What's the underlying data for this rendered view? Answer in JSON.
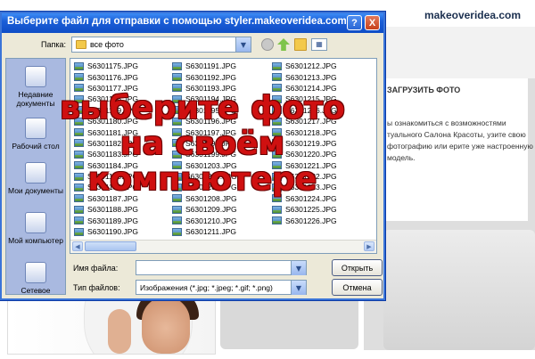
{
  "site": {
    "logo": "makeoveridea.com",
    "panel_title": "ЗАГРУЗИТЬ ФОТО",
    "panel_text": "ы ознакомиться с возможностями туального Салона Красоты, узите свою фотографию или ерите уже настроенную модель."
  },
  "dialog": {
    "title": "Выберите файл для отправки с помощью styler.makeoveridea.com",
    "help_label": "?",
    "close_label": "X",
    "folder_label": "Папка:",
    "folder_value": "все фото",
    "views_icon": "views-menu-icon",
    "places": [
      {
        "label": "Недавние документы",
        "icon": "recent-documents-icon"
      },
      {
        "label": "Рабочий стол",
        "icon": "desktop-icon"
      },
      {
        "label": "Мои документы",
        "icon": "my-documents-icon"
      },
      {
        "label": "Мой компьютер",
        "icon": "my-computer-icon"
      },
      {
        "label": "Сетевое",
        "icon": "network-icon"
      }
    ],
    "files": {
      "col1": [
        "S6301175.JPG",
        "S6301176.JPG",
        "S6301177.JPG",
        "S6301178.JPG",
        "S6301179.JPG",
        "S6301180.JPG",
        "S6301181.JPG",
        "S6301182.JPG",
        "S6301183.JPG",
        "S6301184.JPG",
        "S6301185.JPG",
        "S6301186.JPG",
        "S6301187.JPG",
        "S6301188.JPG",
        "S6301189.JPG",
        "S6301190.JPG"
      ],
      "col2": [
        "S6301191.JPG",
        "S6301192.JPG",
        "S6301193.JPG",
        "S6301194.JPG",
        "S6301195.JPG",
        "S6301196.JPG",
        "S6301197.JPG",
        "S6301198.JPG",
        "S6301199.JPG",
        "S6301203.JPG",
        "S6301206.JPG",
        "S6301207.JPG",
        "S6301208.JPG",
        "S6301209.JPG",
        "S6301210.JPG",
        "S6301211.JPG"
      ],
      "col3": [
        "S6301212.JPG",
        "S6301213.JPG",
        "S6301214.JPG",
        "S6301215.JPG",
        "S6301216.JPG",
        "S6301217.JPG",
        "S6301218.JPG",
        "S6301219.JPG",
        "S6301220.JPG",
        "S6301221.JPG",
        "S6301222.JPG",
        "S6301223.JPG",
        "S6301224.JPG",
        "S6301225.JPG",
        "S6301226.JPG"
      ]
    },
    "filename_label": "Имя файла:",
    "filename_value": "",
    "filetype_label": "Тип файлов:",
    "filetype_value": "Изображения (*.jpg; *.jpeg; *.gif; *.png)",
    "open_button": "Открыть",
    "cancel_button": "Отмена"
  },
  "overlay": {
    "line1": "выберите фото",
    "line2": "на своём",
    "line3": "компьютере",
    "color": "#cf1010"
  }
}
